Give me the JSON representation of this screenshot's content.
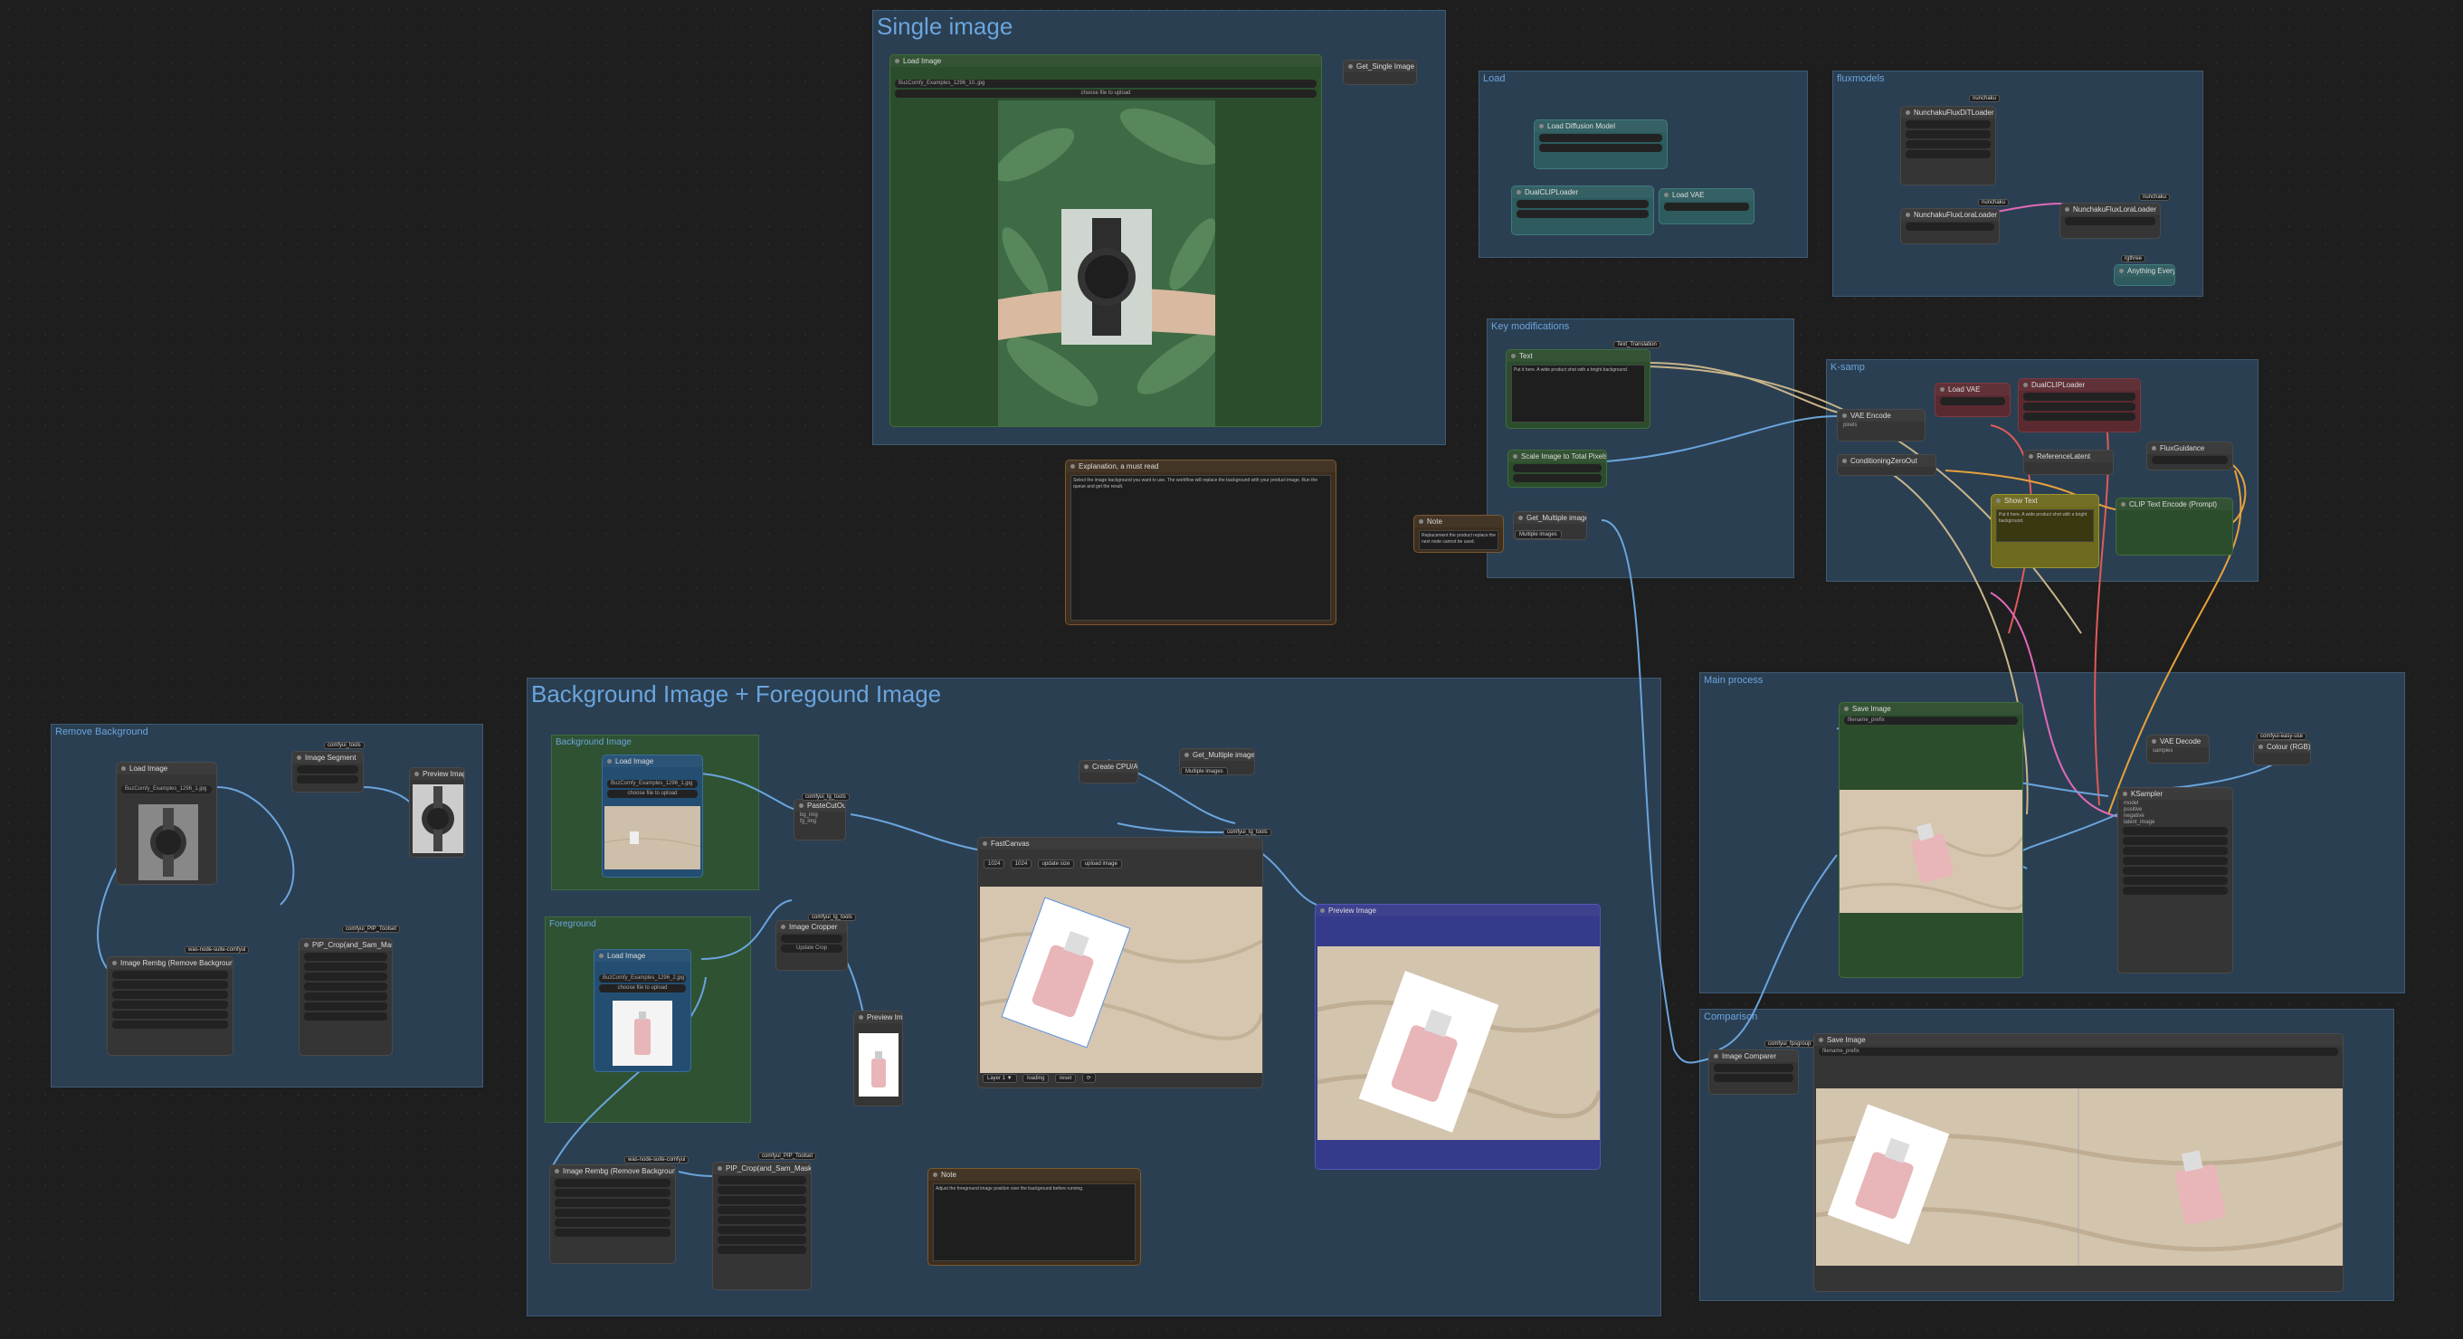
{
  "groups": {
    "single_image": "Single image",
    "bg_fg": "Background Image + Foregound Image",
    "remove_bg": "Remove Background",
    "load": "Load",
    "flux": "fluxmodels",
    "key_mod": "Key modifications",
    "sampling": "K-samp",
    "main_process": "Main process",
    "comparison": "Comparison",
    "background_sub": "Background Image",
    "foreground_sub": "Foreground"
  },
  "nodes": {
    "single_load_image": "Load Image",
    "single_load_file": "BuzComfy_Examples_1296_10..jpg",
    "single_upload": "choose file to upload",
    "single_get_image": "Get_Single Image",
    "explanation_title": "Explanation, a must read",
    "explanation_body": "Select the image background you want to use.\nThe workflow will replace the background with your product image.\nRun the queue and get the result.",
    "note_title": "Note",
    "note_body": "Replacement the product replace the next node cannot be used.",
    "load_node_a": "Load Diffusion Model",
    "load_node_b": "DualCLIPLoader",
    "load_node_c": "Load VAE",
    "flux_loader_a": "NunchakuFluxDiTLoader",
    "flux_loader_b": "NunchakuFluxLoraLoader",
    "flux_loader_c": "NunchakuFluxLoraLoader",
    "flux_badge": "nunchaku",
    "flux_badge_2": "nunchaku",
    "flux_badge_3": "nunchaku",
    "flux_badge_4": "rgthree",
    "text_node": "Text",
    "text_badge": "Text_Translation",
    "text_body": "Put it here. A wide product shot with a bright background.",
    "scale_node": "Scale Image to Total Pixels",
    "get_multiple": "Get_Multiple images",
    "get_multiple_btn": "Multiple images",
    "ks_vae_encode": "VAE Encode",
    "ks_load_vae": "Load VAE",
    "ks_dual_clip": "DualCLIPLoader",
    "ks_ref_latent": "ReferenceLatent",
    "ks_flux_guidance": "FluxGuidance",
    "ks_clip_text": "CLIP Text Encode (Prompt)",
    "ks_cond_zero": "ConditioningZeroOut",
    "ks_show_text": "Show Text",
    "bgfg_load_a": "Load Image",
    "bgfg_file_a": "BuzComfy_Examples_1296_1.jpg",
    "bgfg_load_b": "Load Image",
    "bgfg_file_b": "BuzComfy_Examples_1296_2.jpg",
    "bgfg_upload": "choose file to upload",
    "paste_cut": "PasteCutOut",
    "image_cropper": "Image Cropper",
    "preview_small": "Preview Image",
    "create_cloud": "Create CPU/AI Cloud",
    "get_multiple_2": "Get_Multiple images",
    "fast_canvas": "FastCanvas",
    "canvas_btns": [
      "1024",
      "1024",
      "update size",
      "upload image"
    ],
    "canvas_footer": [
      "Layer 1 ▼",
      "loading",
      "reset",
      "⟳"
    ],
    "preview_image_big": "Preview Image",
    "note_bottom_title": "Note",
    "note_bottom_body": "Adjust the foreground image position over the background before running.",
    "rembg_a": "Image Rembg (Remove Background)",
    "rembg_b": "PIP_Crop(and_Sam_Mask",
    "remove_load": "Load Image",
    "remove_file": "BuzComfy_Examples_1296_1.jpg",
    "remove_preview": "Preview Image",
    "remove_mask": "Image Segment",
    "main_save": "Save Image",
    "main_ksampler": "KSampler",
    "main_vae_decode": "VAE Decode",
    "main_colour": "Colour (RGB) Input",
    "comp_image_comparer": "Image Comparer",
    "comp_save": "Save Image",
    "comp_badge": "comfyui_fpsgroup",
    "bgfg_badge_1": "comfyui_lg_tools",
    "bgfg_badge_2": "comfyui_lg_tools",
    "bgfg_badge_3": "comfyui_lg_tools",
    "bgfg_badge_4": "was-node-suite-comfyui",
    "bgfg_badge_5": "comfyui_PIP_Toolset",
    "remove_badge_1": "comfyui_tools",
    "remove_badge_2": "was-node-suite-comfyui",
    "remove_badge_3": "comfyui_PIP_Toolset",
    "main_badge": "comfyui-easy-use",
    "multiple_badge": "comfyui-easy-use"
  },
  "colors": {
    "group_bg": "#2b3f52",
    "group_title": "#6aa5dd",
    "link_blue": "#6aa5dd",
    "link_orange": "#e8a23a",
    "link_pink": "#e06ab8",
    "link_red": "#e05a5a",
    "link_tan": "#c8b48a"
  }
}
